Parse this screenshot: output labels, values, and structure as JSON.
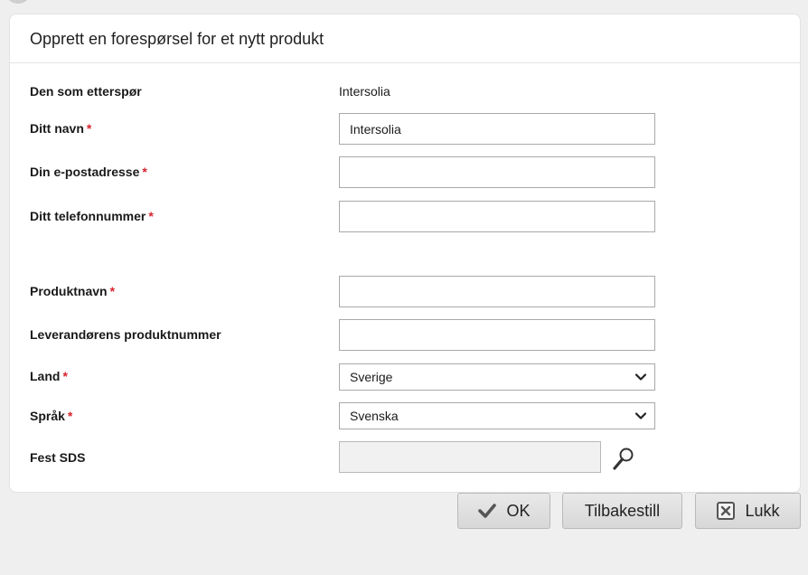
{
  "dialog": {
    "title": "Opprett en forespørsel for et nytt produkt"
  },
  "form": {
    "required_mark": "*",
    "requester": {
      "label": "Den som etterspør",
      "value": "Intersolia"
    },
    "name": {
      "label": "Ditt navn",
      "value": "Intersolia",
      "required": true
    },
    "email": {
      "label": "Din e-postadresse",
      "value": "",
      "required": true
    },
    "phone": {
      "label": "Ditt telefonnummer",
      "value": "",
      "required": true
    },
    "product_name": {
      "label": "Produktnavn",
      "value": "",
      "required": true
    },
    "supplier_product_number": {
      "label": "Leverandørens produktnummer",
      "value": ""
    },
    "country": {
      "label": "Land",
      "value": "Sverige",
      "required": true
    },
    "language": {
      "label": "Språk",
      "value": "Svenska",
      "required": true
    },
    "sds": {
      "label": "Fest SDS",
      "value": "",
      "icon": "magnifier-icon"
    }
  },
  "buttons": {
    "ok": {
      "label": "OK",
      "icon": "checkmark-icon"
    },
    "reset": {
      "label": "Tilbakestill"
    },
    "close": {
      "label": "Lukk",
      "icon": "close-box-icon"
    }
  },
  "colors": {
    "required": "#d9232e",
    "dialog_bg": "#ffffff",
    "page_bg": "#efefef"
  }
}
